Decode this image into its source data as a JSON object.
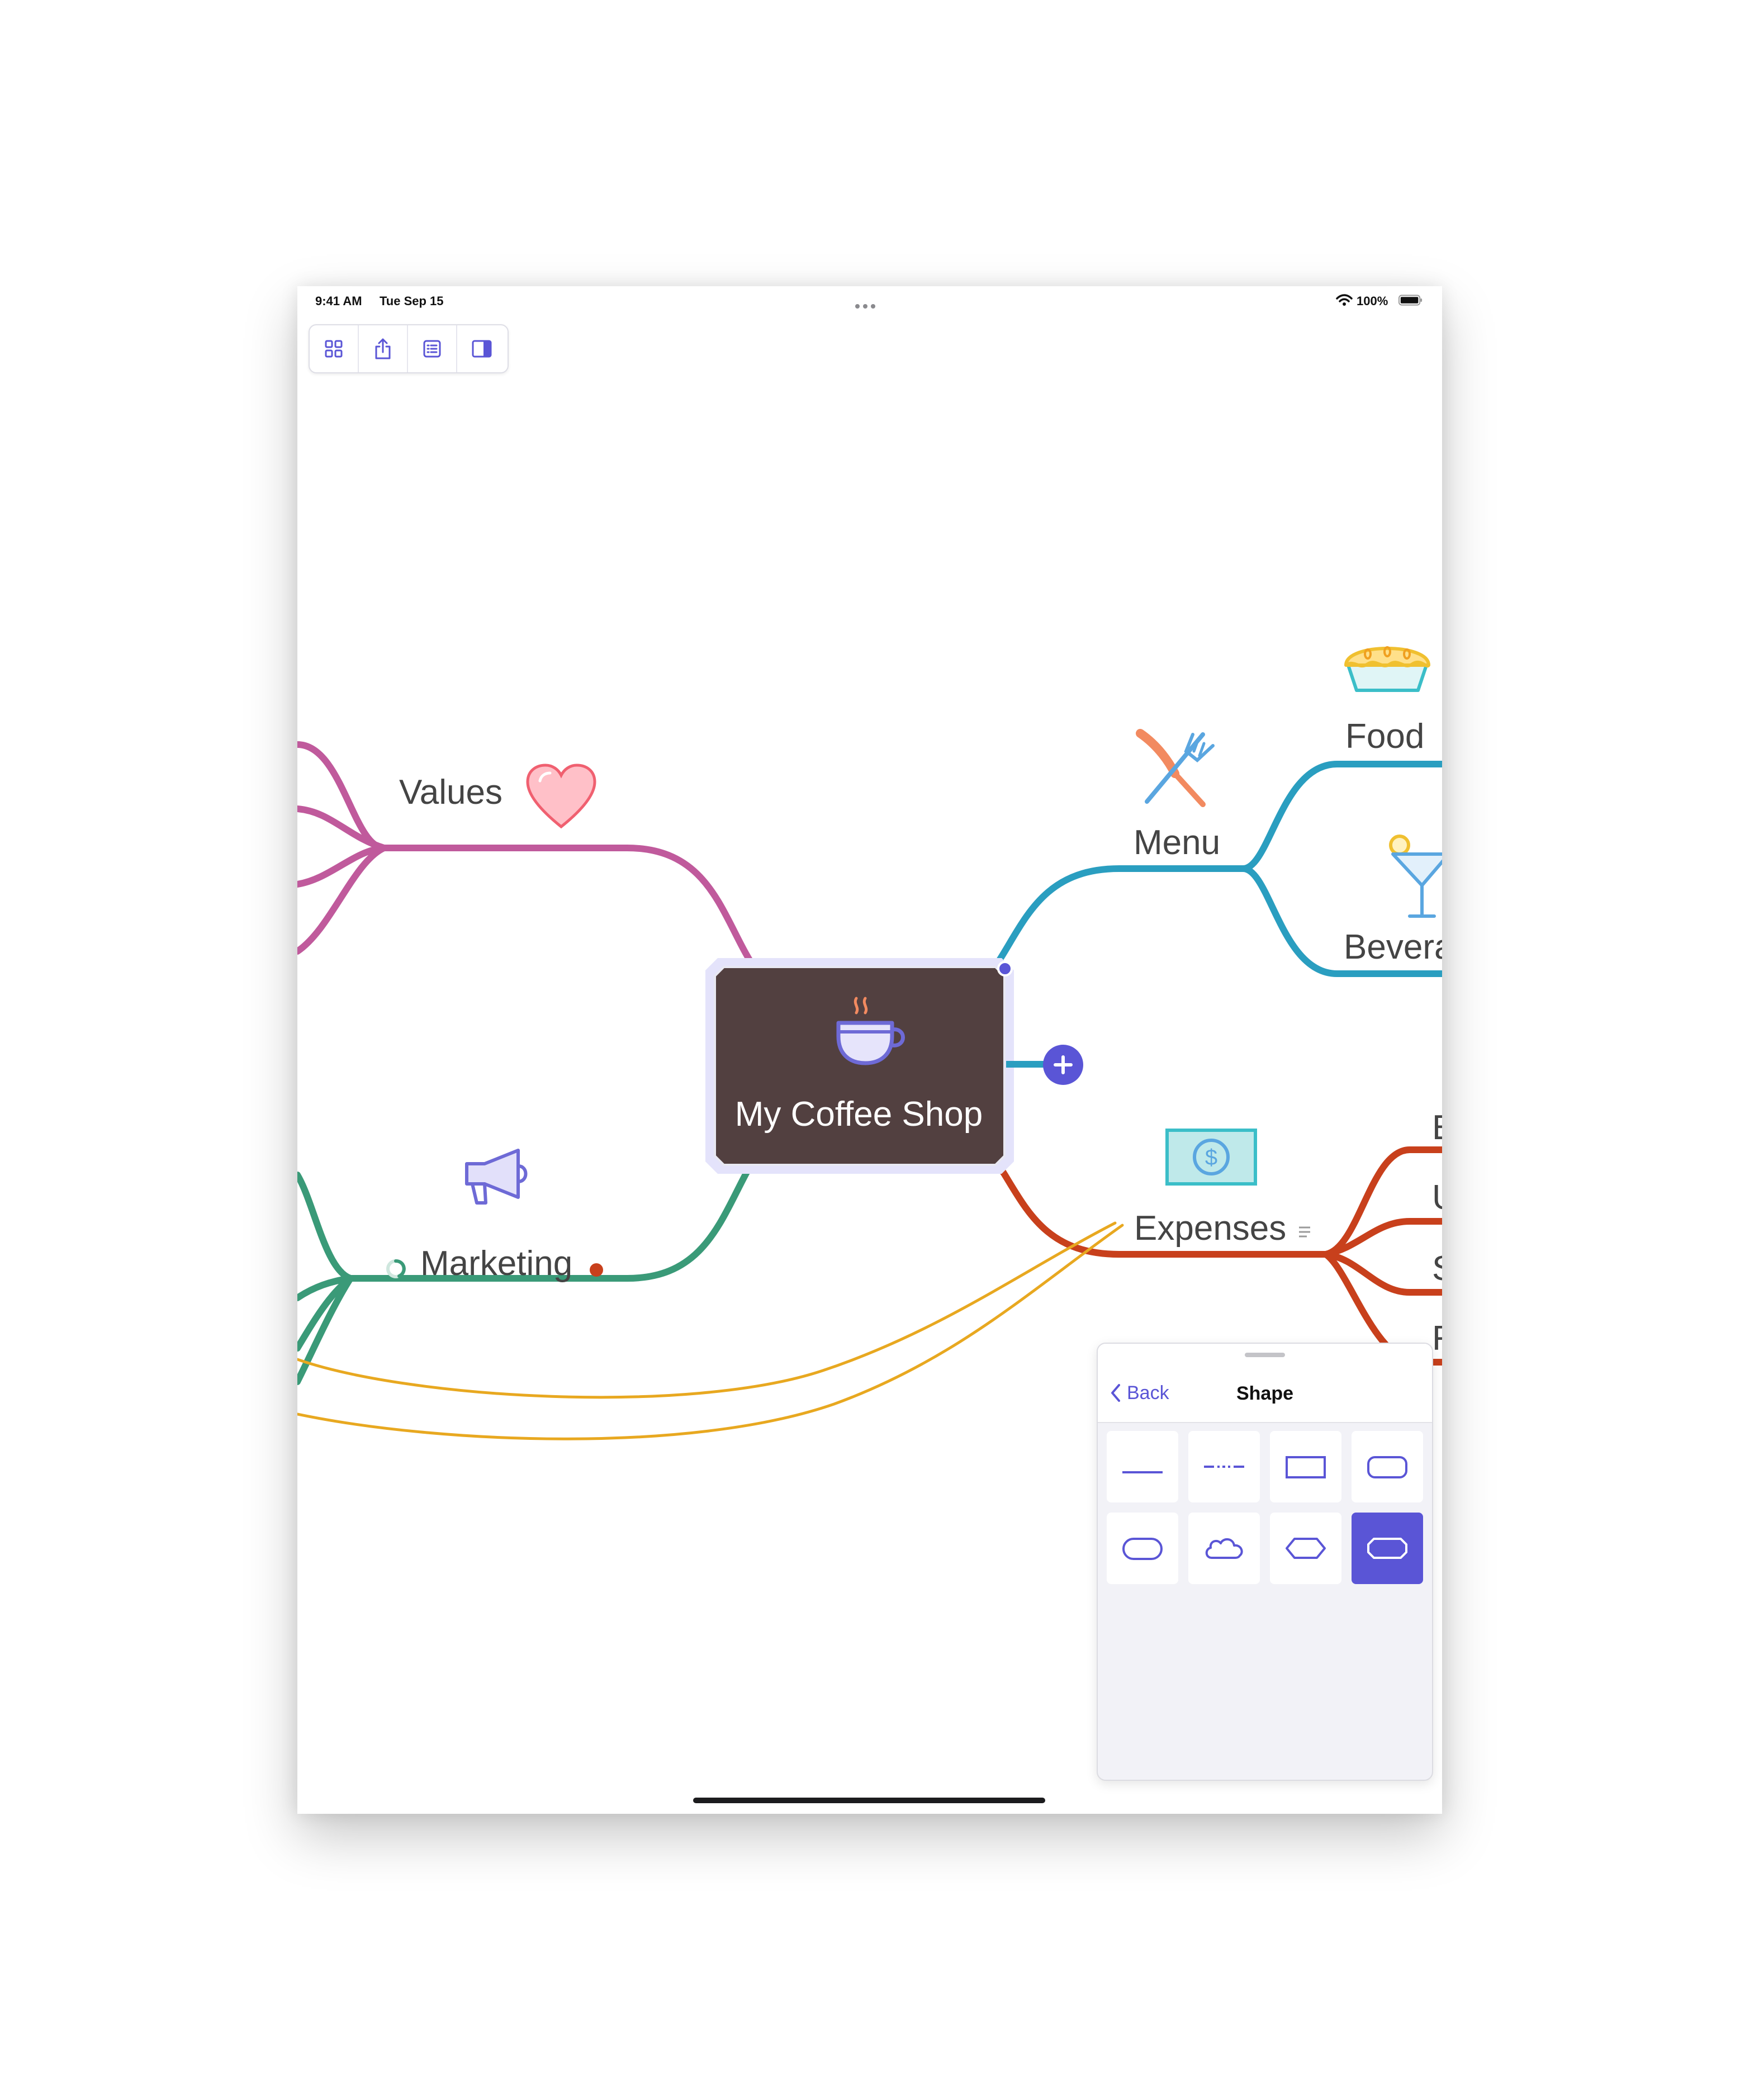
{
  "status_bar": {
    "time": "9:41 AM",
    "date": "Tue Sep 15",
    "battery": "100%",
    "wifi_icon": "wifi-icon",
    "battery_icon": "battery-icon"
  },
  "toolbar": {
    "buttons": [
      {
        "icon": "grid-icon"
      },
      {
        "icon": "share-icon"
      },
      {
        "icon": "outline-icon"
      },
      {
        "icon": "sidebar-icon"
      }
    ]
  },
  "mindmap": {
    "central": {
      "label": "My Coffee Shop",
      "icon": "coffee-cup-icon",
      "fill": "#524040"
    },
    "branches": {
      "values": {
        "label": "Values",
        "color": "#c05a9c",
        "icon": "heart-icon"
      },
      "marketing": {
        "label": "Marketing",
        "color": "#3a9a78",
        "icon": "megaphone-icon"
      },
      "menu": {
        "label": "Menu",
        "color": "#2a9ec0",
        "icon": "fork-knife-icon"
      },
      "expenses": {
        "label": "Expenses",
        "color": "#c8401c",
        "icon": "money-icon"
      },
      "food": {
        "label": "Food",
        "icon": "pie-icon"
      },
      "beverages": {
        "label": "Bevera",
        "icon": "cocktail-icon"
      },
      "expense_children": [
        "E",
        "U",
        "S",
        "R"
      ]
    },
    "relation_color": "#e8a820"
  },
  "panel": {
    "back_label": "Back",
    "title": "Shape",
    "shapes": [
      {
        "name": "line",
        "selected": false
      },
      {
        "name": "dashed-line",
        "selected": false
      },
      {
        "name": "rectangle",
        "selected": false
      },
      {
        "name": "rounded-rectangle",
        "selected": false
      },
      {
        "name": "capsule",
        "selected": false
      },
      {
        "name": "cloud",
        "selected": false
      },
      {
        "name": "hexagon",
        "selected": false
      },
      {
        "name": "octagon",
        "selected": true
      }
    ]
  }
}
